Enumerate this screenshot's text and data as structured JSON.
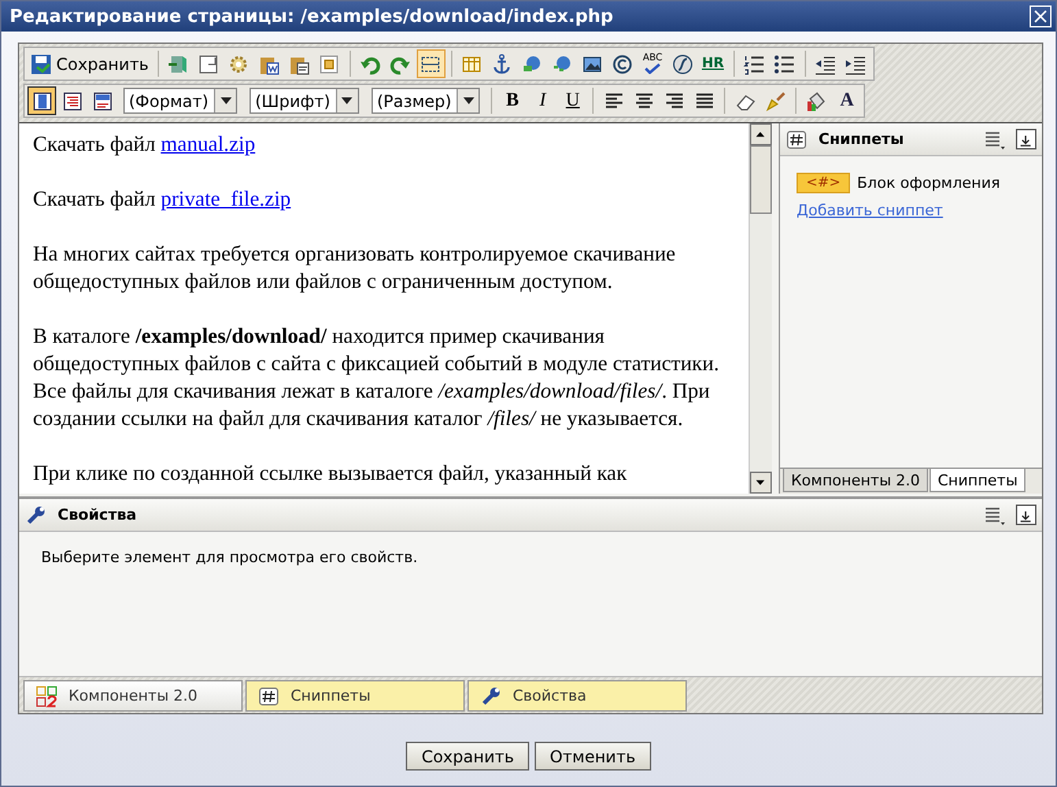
{
  "window": {
    "title": "Редактирование страницы: /examples/download/index.php"
  },
  "toolbar_top": [
    {
      "kind": "save",
      "label": "Сохранить",
      "selected": false
    },
    {
      "kind": "sep"
    },
    {
      "kind": "icon",
      "selected": false
    },
    {
      "kind": "icon",
      "selected": false
    },
    {
      "kind": "icon",
      "selected": false
    },
    {
      "kind": "icon",
      "selected": false
    },
    {
      "kind": "icon",
      "selected": false
    },
    {
      "kind": "icon",
      "selected": false
    },
    {
      "kind": "sep"
    },
    {
      "kind": "icon",
      "selected": false
    },
    {
      "kind": "icon",
      "selected": false
    },
    {
      "kind": "icon",
      "selected": true
    },
    {
      "kind": "sep"
    },
    {
      "kind": "icon",
      "selected": false
    },
    {
      "kind": "icon",
      "selected": false
    },
    {
      "kind": "icon",
      "selected": false
    },
    {
      "kind": "icon",
      "selected": false
    },
    {
      "kind": "icon",
      "selected": false
    },
    {
      "kind": "icon",
      "selected": false
    },
    {
      "kind": "spell",
      "label": "ABC"
    },
    {
      "kind": "icon",
      "selected": false
    },
    {
      "kind": "hr",
      "label": "HR",
      "selected": false
    },
    {
      "kind": "sep"
    },
    {
      "kind": "icon",
      "selected": false
    },
    {
      "kind": "icon",
      "selected": false
    },
    {
      "kind": "sep"
    },
    {
      "kind": "icon",
      "selected": false
    },
    {
      "kind": "icon",
      "selected": false
    }
  ],
  "toolbar_format": [
    {
      "kind": "icon",
      "selected": true
    },
    {
      "kind": "icon",
      "selected": false
    },
    {
      "kind": "icon",
      "selected": false
    },
    {
      "kind": "select",
      "label": "(Формат)"
    },
    {
      "kind": "select",
      "label": "(Шрифт)"
    },
    {
      "kind": "select",
      "label": "(Размер)"
    },
    {
      "kind": "sep"
    },
    {
      "kind": "bold",
      "label": "B",
      "selected": false
    },
    {
      "kind": "italic",
      "label": "I",
      "selected": false
    },
    {
      "kind": "underline",
      "label": "U",
      "selected": false
    },
    {
      "kind": "sep"
    },
    {
      "kind": "icon",
      "selected": false
    },
    {
      "kind": "icon",
      "selected": false
    },
    {
      "kind": "icon",
      "selected": false
    },
    {
      "kind": "icon",
      "selected": false
    },
    {
      "kind": "sep"
    },
    {
      "kind": "icon",
      "selected": false
    },
    {
      "kind": "icon",
      "selected": false
    },
    {
      "kind": "sep"
    },
    {
      "kind": "icon",
      "selected": false
    },
    {
      "kind": "fontcolor",
      "label": "A",
      "selected": false
    }
  ],
  "editor": {
    "paragraphs": [
      {
        "text": "Скачать файл",
        "link": "manual.zip"
      },
      {
        "text": "Скачать файл",
        "link": "private_file.zip"
      },
      {
        "text": "На многих сайтах требуется организовать контролируемое скачивание общедоступных файлов или файлов с ограниченным доступом."
      },
      {
        "text": "В каталоге **/examples/download/** находится пример скачивания общедоступных файлов с сайта с фиксацией событий в модуле статистики. Все файлы для скачивания лежат в каталоге */examples/download/files/*. При создании ссылки на файл для скачивания каталог */files/* не указывается."
      },
      {
        "text": "При клике по созданной ссылке вызывается файл, указанный как"
      }
    ]
  },
  "snippets_panel": {
    "title": "Сниппеты",
    "items": [
      {
        "badge": "<#>",
        "label": "Блок оформления"
      }
    ],
    "add_link": "Добавить сниппет",
    "tabs": [
      {
        "label": "Компоненты 2.0",
        "selected": false
      },
      {
        "label": "Сниппеты",
        "selected": true
      }
    ]
  },
  "properties_panel": {
    "title": "Свойства",
    "message": "Выберите элемент для просмотра его свойств."
  },
  "bottom_tabs": [
    {
      "label": "Компоненты 2.0",
      "active": false
    },
    {
      "label": "Сниппеты",
      "active": true
    },
    {
      "label": "Свойства",
      "active": true
    }
  ],
  "buttons": [
    "Сохранить",
    "Отменить"
  ]
}
